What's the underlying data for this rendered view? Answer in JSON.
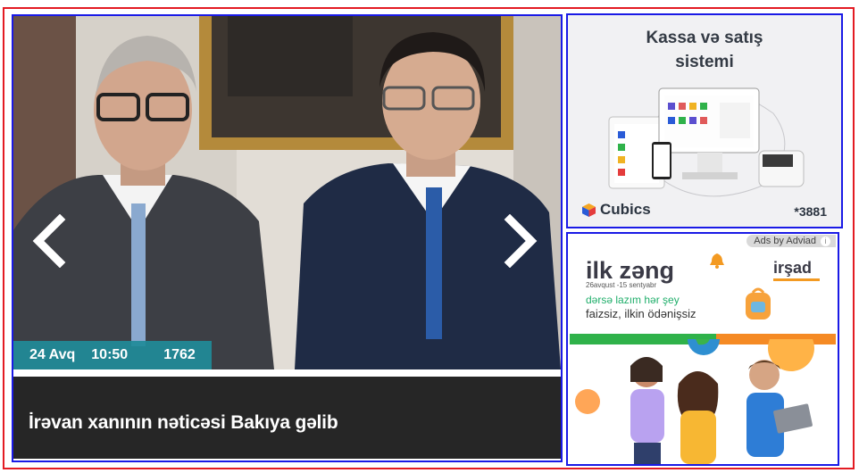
{
  "slider": {
    "date": "24 Avq",
    "time": "10:50",
    "views": "1762",
    "caption": "İrəvan xanının nəticəsi Bakıya gəlib",
    "prev_icon": "chevron-left-icon",
    "next_icon": "chevron-right-icon"
  },
  "ad_cubics": {
    "title_line1": "Kassa və satış",
    "title_line2": "sistemi",
    "brand": "Cubics",
    "shortcode": "*3881"
  },
  "ad_irshad": {
    "ads_by": "Ads by Adviad",
    "headline": "ilk zəng",
    "brand": "irşad",
    "dates": "26avqust -15 sentyabr",
    "line1": "dərsə lazım hər şey",
    "line2": "faizsiz, ilkin ödənişsiz"
  },
  "colors": {
    "frame_red": "#e31b23",
    "box_blue": "#1a1ae6",
    "meta_teal": "#1f8b99",
    "caption_bg": "#262626"
  }
}
